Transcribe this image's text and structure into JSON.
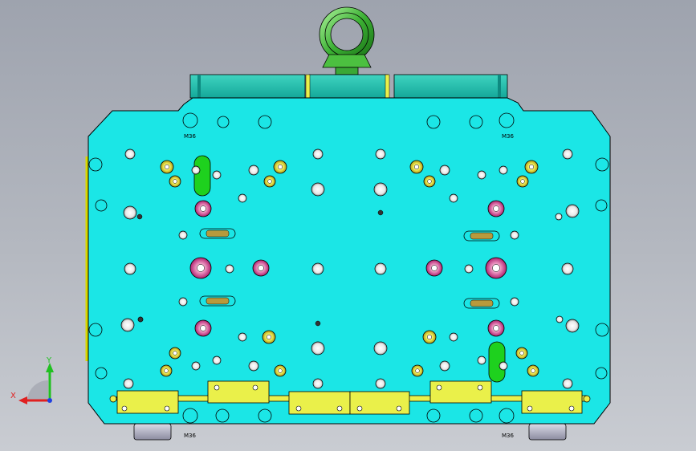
{
  "viewport": {
    "background_top": "#9ea3ae",
    "background_bottom": "#c9ccd2"
  },
  "model": {
    "plate_color": "#1be6e6",
    "rail_color": "#eaf04a",
    "lifting_eye_color": "#45c83c",
    "green_insert_color": "#1ed11e",
    "outline_color": "#000000",
    "thread_labels": {
      "top_left": "M36",
      "top_right": "M36",
      "bottom_left": "M36",
      "bottom_right": "M36"
    }
  },
  "triad": {
    "x_label": "X",
    "y_label": "Y",
    "x_color": "#e02020",
    "y_color": "#20c020",
    "z_color": "#2040e0"
  }
}
